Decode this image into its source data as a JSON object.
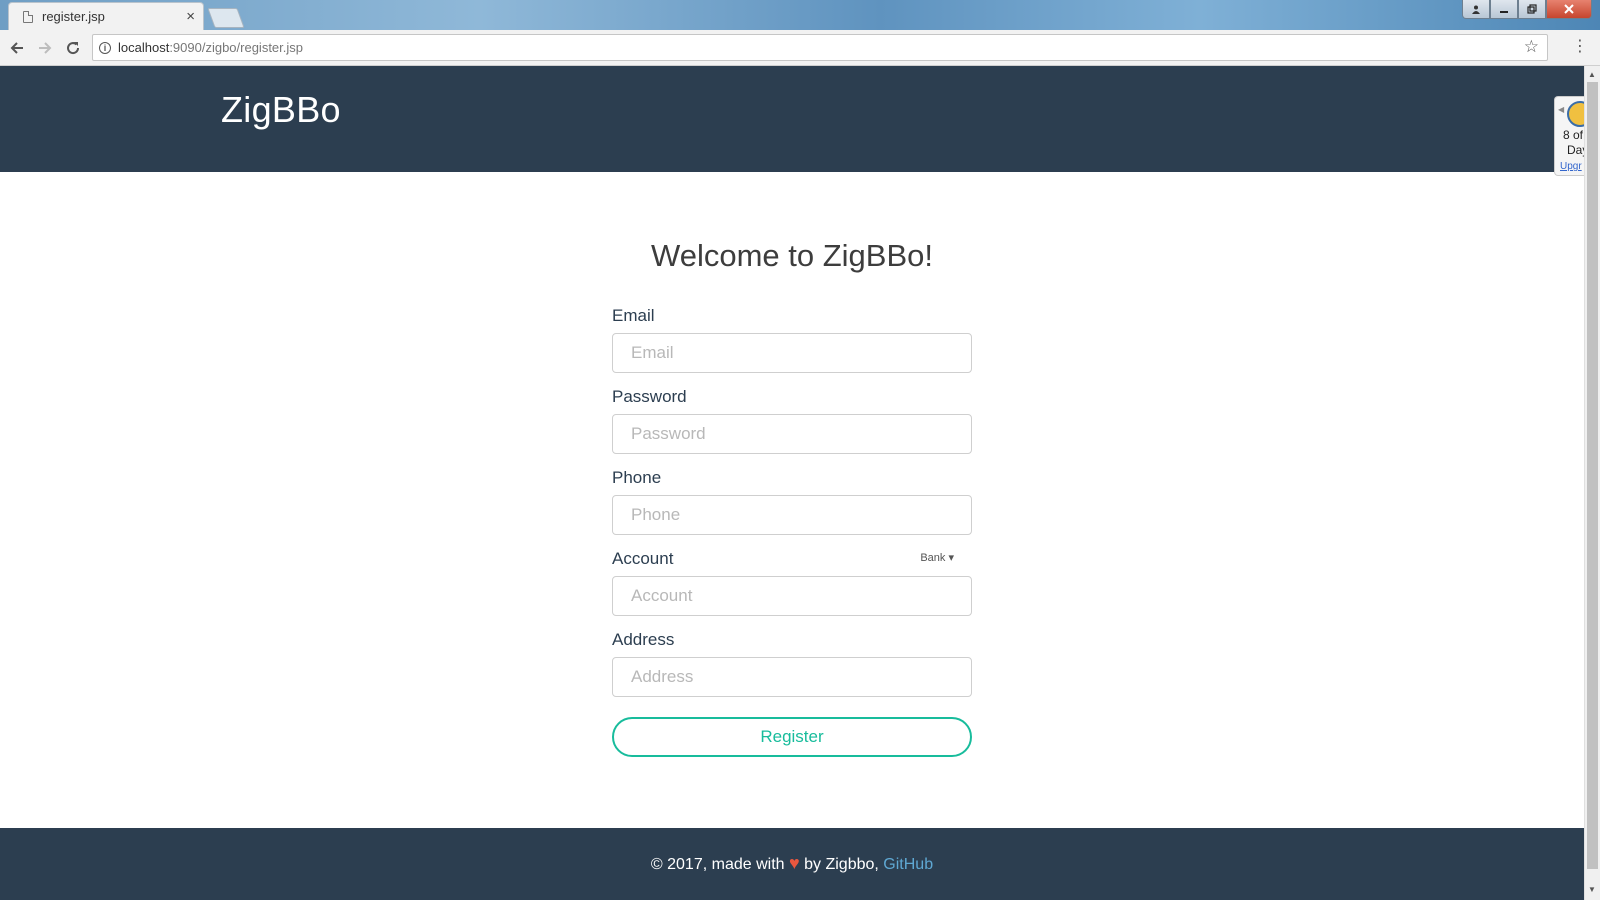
{
  "browser": {
    "tab_title": "register.jsp",
    "tab_close": "×",
    "url_host": "localhost",
    "url_path": ":9090/zigbo/register.jsp",
    "icons": [
      "page-icon",
      "back-icon",
      "forward-icon",
      "reload-icon",
      "info-icon",
      "star-icon",
      "menu-icon",
      "close-icon"
    ]
  },
  "header": {
    "brand": "ZigBBo"
  },
  "side_widget": {
    "line1": "8 of",
    "line2": "Day",
    "link": "Upgr"
  },
  "form": {
    "title": "Welcome to ZigBBo!",
    "fields": [
      {
        "label": "Email",
        "placeholder": "Email"
      },
      {
        "label": "Password",
        "placeholder": "Password"
      },
      {
        "label": "Phone",
        "placeholder": "Phone"
      },
      {
        "label": "Account",
        "placeholder": "Account",
        "dropdown": "Bank"
      },
      {
        "label": "Address",
        "placeholder": "Address"
      }
    ],
    "submit_label": "Register"
  },
  "footer": {
    "prefix": "© 2017, made with",
    "suffix": "by Zigbbo,",
    "link": "GitHub",
    "heart_color": "#e9573f"
  },
  "colors": {
    "navy": "#2c3e50",
    "accent": "#18bc9c",
    "link": "#5fa8d3"
  }
}
